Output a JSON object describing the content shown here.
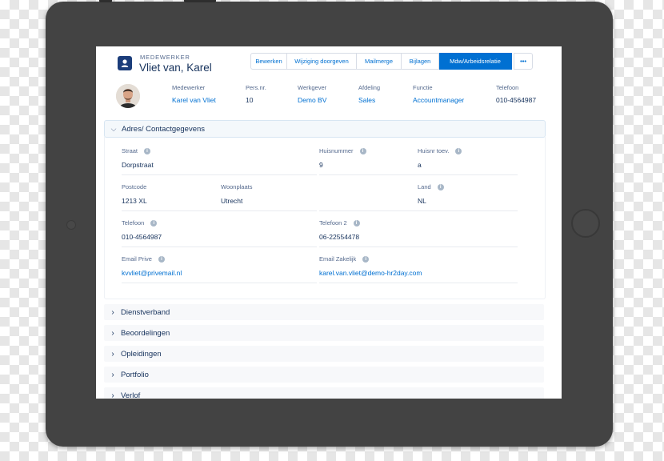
{
  "record": {
    "object_label": "MEDEWERKER",
    "title": "Vliet van, Karel",
    "icon": "person-badge-icon"
  },
  "actions": [
    {
      "label": "Bewerken"
    },
    {
      "label": "Wijziging doorgeven"
    },
    {
      "label": "Mailmerge"
    },
    {
      "label": "Bijlagen"
    },
    {
      "label": "Mdw/Arbeidsrelatie"
    },
    {
      "label": "•••"
    }
  ],
  "highlights": [
    {
      "label": "Medewerker",
      "value": "Karel van Vliet"
    },
    {
      "label": "Pers.nr.",
      "value": "10"
    },
    {
      "label": "Werkgever",
      "value": "Demo BV"
    },
    {
      "label": "Afdeling",
      "value": "Sales"
    },
    {
      "label": "Functie",
      "value": "Accountmanager"
    },
    {
      "label": "Telefoon",
      "value": "010-4564987"
    }
  ],
  "address_section": {
    "title": "Adres/ Contactgegevens",
    "fields": {
      "straat": {
        "label": "Straat",
        "value": "Dorpstraat"
      },
      "huisnummer": {
        "label": "Huisnummer",
        "value": "9"
      },
      "huisnr_toev": {
        "label": "Huisnr toev.",
        "value": "a"
      },
      "postcode": {
        "label": "Postcode",
        "value": "1213 XL"
      },
      "woonplaats": {
        "label": "Woonplaats",
        "value": "Utrecht"
      },
      "land": {
        "label": "Land",
        "value": "NL"
      },
      "telefoon": {
        "label": "Telefoon",
        "value": "010-4564987"
      },
      "telefoon2": {
        "label": "Telefoon 2",
        "value": "06-22554478"
      },
      "email_prive": {
        "label": "Email Prive",
        "value": "kvvliet@privemail.nl"
      },
      "email_zakelijk": {
        "label": "Email Zakelijk",
        "value": "karel.van.vliet@demo-hr2day.com"
      }
    }
  },
  "collapsed_sections": [
    {
      "title": "Dienstverband"
    },
    {
      "title": "Beoordelingen"
    },
    {
      "title": "Opleidingen"
    },
    {
      "title": "Portfolio"
    },
    {
      "title": "Verlof"
    }
  ],
  "colors": {
    "tablet_frame": "#434343",
    "brand_blue": "#0070d2",
    "text_dark": "#16325c",
    "text_label": "#54698d"
  }
}
